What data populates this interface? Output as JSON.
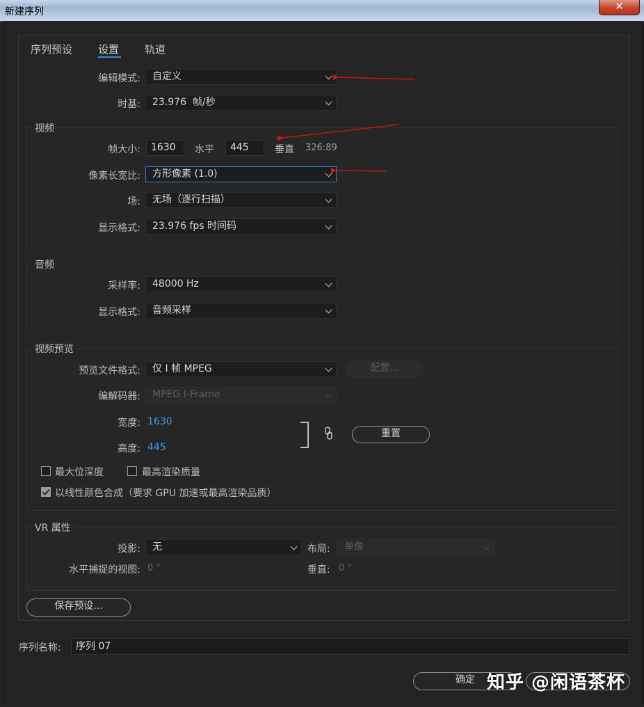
{
  "window": {
    "title": "新建序列",
    "close_icon": "close-icon"
  },
  "tabs": [
    {
      "label": "序列预设"
    },
    {
      "label": "设置"
    },
    {
      "label": "轨道"
    }
  ],
  "settings": {
    "edit_mode_label": "编辑模式:",
    "edit_mode_value": "自定义",
    "timebase_label": "时基:",
    "timebase_value": "23.976  帧/秒"
  },
  "video": {
    "title": "视频",
    "frame_size_label": "帧大小:",
    "width_value": "1630",
    "horizontal_label": "水平",
    "height_value": "445",
    "vertical_label": "垂直",
    "ratio": "326:89",
    "pixel_aspect_label": "像素长宽比:",
    "pixel_aspect_value": "方形像素 (1.0)",
    "fields_label": "场:",
    "fields_value": "无场（逐行扫描）",
    "display_format_label": "显示格式:",
    "display_format_value": "23.976 fps 时间码"
  },
  "audio": {
    "title": "音频",
    "sample_rate_label": "采样率:",
    "sample_rate_value": "48000 Hz",
    "display_format_label": "显示格式:",
    "display_format_value": "音频采样"
  },
  "video_preview": {
    "title": "视频预览",
    "file_format_label": "预览文件格式:",
    "file_format_value": "仅 I 帧 MPEG",
    "configure_button": "配置...",
    "codec_label": "编解码器:",
    "codec_value": "MPEG I-Frame",
    "width_label": "宽度:",
    "width_value": "1630",
    "height_label": "高度:",
    "height_value": "445",
    "reset_button": "重置",
    "max_bit_depth": "最大位深度",
    "max_render_quality": "最高渲染质量",
    "linear_color": "以线性颜色合成（要求 GPU 加速或最高渲染品质）"
  },
  "vr": {
    "title": "VR 属性",
    "projection_label": "投影:",
    "projection_value": "无",
    "layout_label": "布局:",
    "layout_value": "单像",
    "h_capture_label": "水平捕捉的视图:",
    "h_capture_value": "0 °",
    "vertical_label": "垂直:",
    "vertical_value": "0 °"
  },
  "save_preset_button": "保存预设...",
  "sequence_name_label": "序列名称:",
  "sequence_name_value": "序列 07",
  "ok_button": "确定",
  "watermark": "知乎 @闲语茶杯",
  "colors": {
    "accent": "#2d8ceb",
    "annotation_arrow": "#dd1111",
    "value_blue": "#3f9ae8"
  }
}
